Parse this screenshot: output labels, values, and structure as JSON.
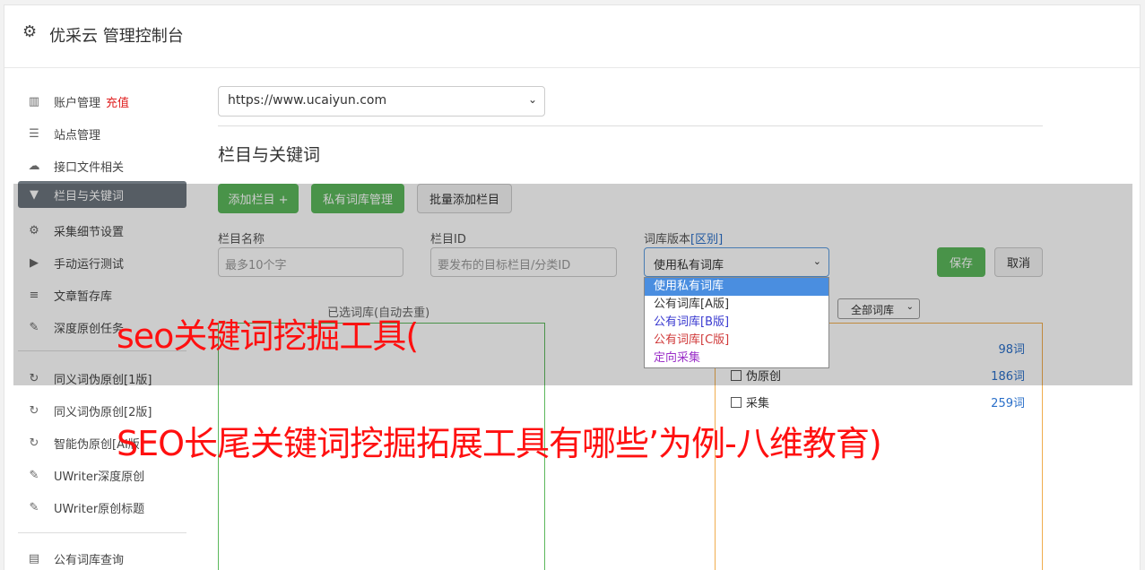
{
  "header": {
    "title": "优采云 管理控制台",
    "icon": "gear-icon"
  },
  "sidebar": {
    "items": [
      {
        "label": "账户管理",
        "badge": "充值",
        "icon": "bar-chart-icon"
      },
      {
        "label": "站点管理",
        "icon": "server-icon"
      },
      {
        "label": "接口文件相关",
        "icon": "cloud-upload-icon"
      },
      {
        "label": "栏目与关键词",
        "icon": "filter-icon",
        "active": true
      },
      {
        "label": "采集细节设置",
        "icon": "cogs-icon"
      },
      {
        "label": "手动运行测试",
        "icon": "play-circle-icon"
      },
      {
        "label": "文章暂存库",
        "icon": "database-icon"
      },
      {
        "label": "深度原创任务",
        "icon": "edit-icon"
      },
      {
        "label": "同义词伪原创[1版]",
        "icon": "refresh-icon"
      },
      {
        "label": "同义词伪原创[2版]",
        "icon": "refresh-icon"
      },
      {
        "label": "智能伪原创[AI版]",
        "icon": "refresh-icon"
      },
      {
        "label": "UWriter深度原创",
        "icon": "edit-icon"
      },
      {
        "label": "UWriter原创标题",
        "icon": "edit-icon"
      },
      {
        "label": "公有词库查询",
        "icon": "book-icon"
      }
    ]
  },
  "main": {
    "site_select": "https://www.ucaiyun.com",
    "section_title": "栏目与关键词",
    "buttons": {
      "add_column": "添加栏目 +",
      "private_lib": "私有词库管理",
      "batch_add": "批量添加栏目",
      "save": "保存",
      "cancel": "取消"
    },
    "form": {
      "column_name_label": "栏目名称",
      "column_name_placeholder": "最多10个字",
      "column_id_label": "栏目ID",
      "column_id_placeholder": "要发布的目标栏目/分类ID",
      "lib_version_label": "词库版本",
      "lib_version_link": "[区别]",
      "lib_version_value": "使用私有词库"
    },
    "dropdown_options": [
      {
        "label": "使用私有词库",
        "color": "#ffffff"
      },
      {
        "label": "公有词库[A版]",
        "color": "#333333"
      },
      {
        "label": "公有词库[B版]",
        "color": "#3a3ad0"
      },
      {
        "label": "公有词库[C版]",
        "color": "#d03a3a"
      },
      {
        "label": "定向采集",
        "color": "#9b30c8"
      }
    ],
    "selected_words_title": "已选词库(自动去重)",
    "lib_filter": "全部词库",
    "lib_list": [
      {
        "label": "",
        "count": "98词"
      },
      {
        "label": "伪原创",
        "count": "186词"
      },
      {
        "label": "采集",
        "count": "259词"
      }
    ]
  },
  "watermark": {
    "line1": "seo关键词挖掘工具(",
    "line2": "SEO长尾关键词挖掘拓展工具有哪些’为例-八维教育)"
  }
}
